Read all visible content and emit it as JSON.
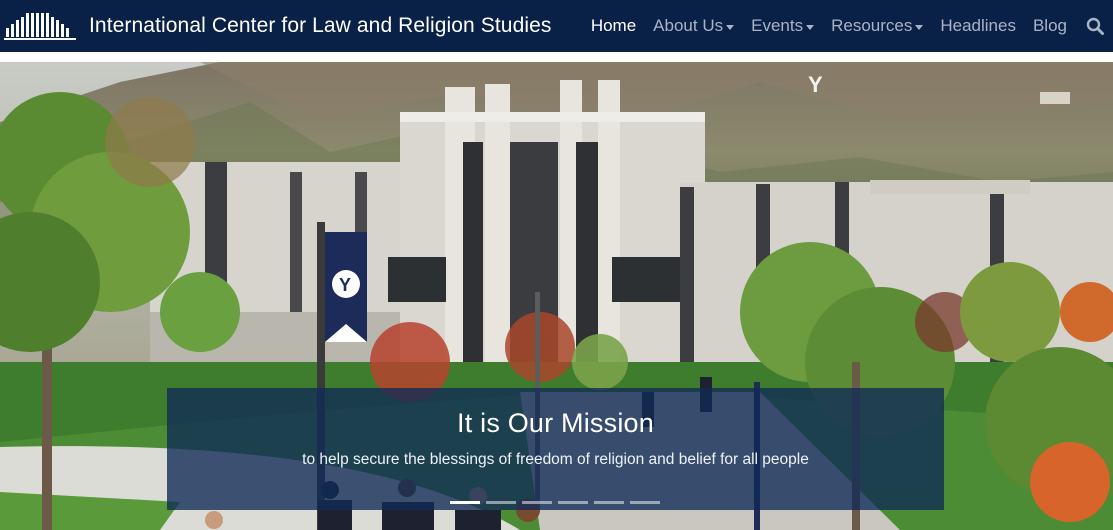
{
  "site": {
    "title": "International Center for Law and Religion Studies",
    "logo": "ICLRS columns logo"
  },
  "nav": {
    "items": [
      {
        "label": "Home",
        "active": true,
        "dropdown": false
      },
      {
        "label": "About Us",
        "active": false,
        "dropdown": true
      },
      {
        "label": "Events",
        "active": false,
        "dropdown": true
      },
      {
        "label": "Resources",
        "active": false,
        "dropdown": true
      },
      {
        "label": "Headlines",
        "active": false,
        "dropdown": false
      },
      {
        "label": "Blog",
        "active": false,
        "dropdown": false
      }
    ],
    "search_icon": "search-icon"
  },
  "hero": {
    "banner_letter": "Y",
    "caption": {
      "title": "It is Our Mission",
      "text": "to help secure the blessings of freedom of religion and belief for all people"
    },
    "slides_total": 6,
    "active_slide": 1
  },
  "colors": {
    "navbar": "#0a2147",
    "caption_bg": "#102a56",
    "nav_text": "#a8b3c6",
    "nav_active": "#ffffff"
  }
}
